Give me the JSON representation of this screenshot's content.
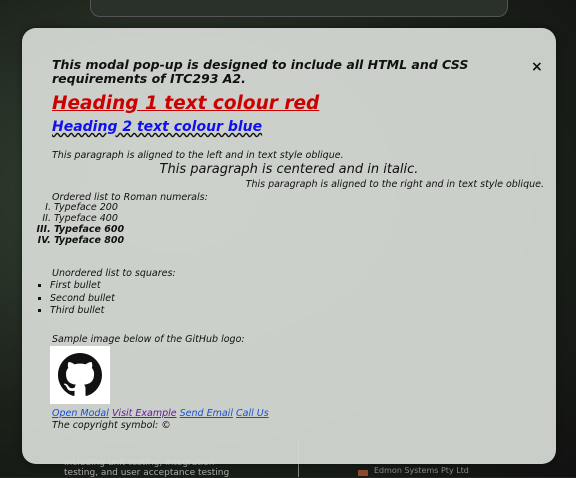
{
  "modal": {
    "close_label": "×",
    "intro": "This modal pop-up is designed to include all HTML and CSS requirements of ITC293 A2.",
    "heading1": "Heading 1 text colour red",
    "heading2": "Heading 2 text colour blue",
    "p_left": "This paragraph is aligned to the left and in text style oblique.",
    "p_center": "This paragraph is centered and in italic.",
    "p_right": "This paragraph is aligned to the right and in text style oblique.",
    "ordered_label": "Ordered list to Roman numerals:",
    "ordered_items": [
      "Typeface 200",
      "Typeface 400",
      "Typeface 600",
      "Typeface 800"
    ],
    "unordered_label": "Unordered list to squares:",
    "unordered_items": [
      "First bullet",
      "Second bullet",
      "Third bullet"
    ],
    "image_label": "Sample image below of the GitHub logo:",
    "image_icon": "github-logo",
    "links": [
      "Open Modal",
      "Visit Example",
      "Send Email",
      "Call Us"
    ],
    "copyright": "The copyright symbol: ©"
  },
  "backdrop": {
    "text_lines": [
      "including unit testing, integration",
      "testing, and user acceptance testing"
    ],
    "right_text": "Edmon Systems Pty Ltd"
  },
  "colors": {
    "heading1": "#cc0000",
    "heading2": "#1010ee",
    "link": "#1a4fd6",
    "visited_link": "#6a1a9a"
  }
}
